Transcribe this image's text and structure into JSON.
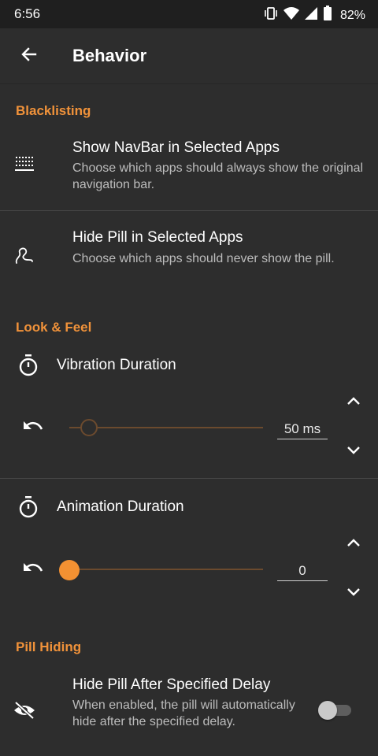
{
  "status_bar": {
    "time": "6:56",
    "battery_percent": "82%",
    "icons": [
      "vibrate-icon",
      "wifi-icon",
      "signal-icon",
      "battery-icon"
    ]
  },
  "app_bar": {
    "title": "Behavior",
    "back_icon": "arrow-back-icon"
  },
  "sections": {
    "blacklisting": {
      "header": "Blacklisting",
      "items": [
        {
          "title": "Show NavBar in Selected Apps",
          "summary": "Choose which apps should always show the original navigation bar.",
          "icon": "navbar-keyboard-icon"
        },
        {
          "title": "Hide Pill in Selected Apps",
          "summary": "Choose which apps should never show the pill.",
          "icon": "squiggle-icon"
        }
      ]
    },
    "look_feel": {
      "header": "Look & Feel",
      "sliders": [
        {
          "title": "Vibration Duration",
          "value_text": "50 ms",
          "value_fraction": 0.1,
          "thumb_style": "hollow",
          "icon": "timer-icon"
        },
        {
          "title": "Animation Duration",
          "value_text": "0",
          "value_fraction": 0,
          "thumb_style": "filled",
          "icon": "timer-icon"
        }
      ]
    },
    "pill_hiding": {
      "header": "Pill Hiding",
      "items": [
        {
          "title": "Hide Pill After Specified Delay",
          "summary": "When enabled, the pill will automatically hide after the specified delay.",
          "icon": "eye-off-icon",
          "toggle_on": false
        }
      ]
    }
  },
  "colors": {
    "accent": "#f39132",
    "background": "#2d2d2d",
    "status_bar": "#1f1f1f",
    "text_secondary": "#bcbcbc"
  }
}
